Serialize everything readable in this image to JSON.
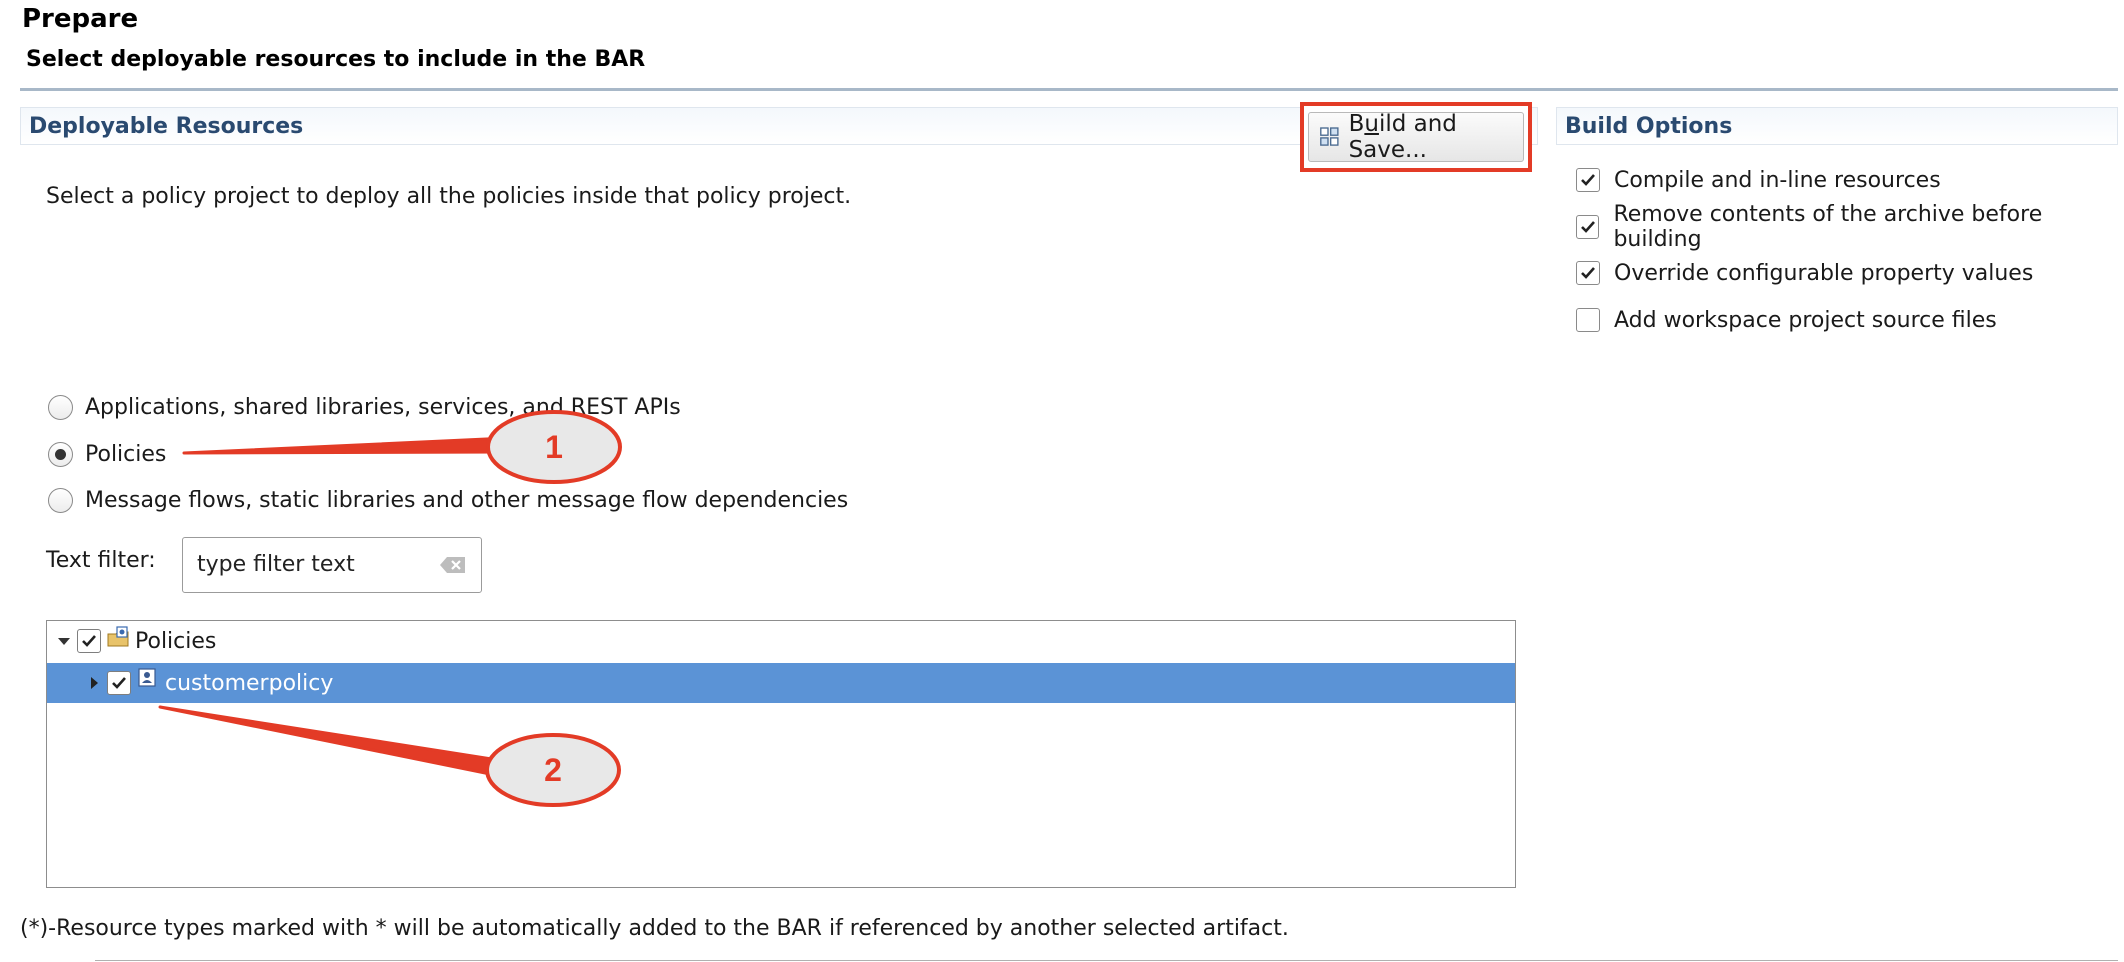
{
  "header": {
    "title": "Prepare",
    "subtitle": "Select deployable resources to include in the BAR"
  },
  "deployable_resources": {
    "title": "Deployable Resources",
    "build_button": {
      "label_pre": "B",
      "label_mnemonic": "u",
      "label_post": "ild and Save...",
      "icon": "build-icon"
    },
    "description": "Select a policy project to deploy all the policies inside that policy project.",
    "options": [
      {
        "label": "Applications, shared libraries, services, and REST APIs",
        "selected": false
      },
      {
        "label": "Policies",
        "selected": true
      },
      {
        "label": "Message flows, static libraries and other message flow dependencies",
        "selected": false
      }
    ],
    "filter": {
      "label": "Text filter:",
      "value": "type filter text",
      "icon": "clear-filter-icon"
    },
    "tree": [
      {
        "label": "Policies",
        "checked": true,
        "expanded": true,
        "icon": "policy-project-icon",
        "selected": false
      },
      {
        "label": "customerpolicy",
        "checked": true,
        "expanded": false,
        "icon": "policy-icon",
        "selected": true
      }
    ],
    "footnote": "(*)-Resource types marked with * will be automatically added to the BAR if referenced by another selected artifact."
  },
  "build_options": {
    "title": "Build Options",
    "items": [
      {
        "label": "Compile and in-line resources",
        "checked": true
      },
      {
        "label": "Remove contents of the archive before building",
        "checked": true
      },
      {
        "label": "Override configurable property values",
        "checked": true
      },
      {
        "label": "Add workspace project source files",
        "checked": false
      }
    ]
  },
  "callouts": [
    {
      "number": "1"
    },
    {
      "number": "2"
    }
  ],
  "colors": {
    "highlight_border": "#e33b26",
    "selection": "#5b93d6",
    "section_title": "#2a4a70",
    "callout_fill": "#e8e8e8"
  }
}
